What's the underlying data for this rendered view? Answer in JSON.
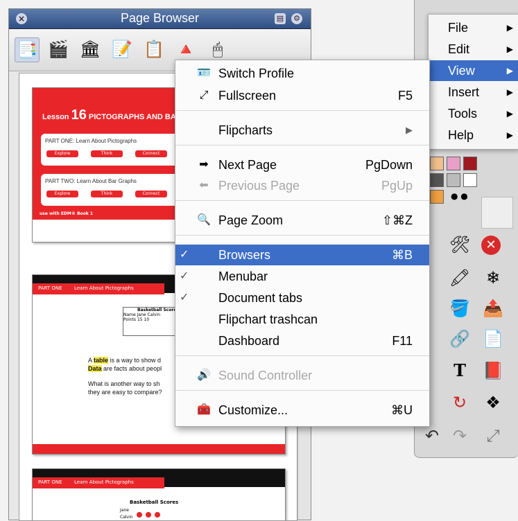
{
  "page_browser": {
    "title": "Page Browser",
    "close_glyph": "×",
    "toolbar_icons": [
      "page-browser-icon",
      "resource-browser-icon",
      "object-browser-icon",
      "notes-browser-icon",
      "property-browser-icon",
      "action-browser-icon",
      "voting-browser-icon"
    ],
    "thumb1": {
      "lesson_word": "Lesson",
      "lesson_num": "16",
      "lesson_title": "PICTOGRAPHS AND BA",
      "part1": "PART ONE: Learn About Pictographs",
      "part2": "PART TWO: Learn About Bar Graphs",
      "buttons": [
        "Explore",
        "Think",
        "Connect"
      ],
      "footer": "use with EDM® Book 1"
    },
    "thumb2": {
      "tab_part": "PART ONE",
      "tab_title": "Learn About Pictographs",
      "table_title": "Basketball Scores",
      "table_rows": [
        "Name",
        "Points"
      ],
      "table_cols": [
        "Jane",
        "Calvin"
      ],
      "table_nums": [
        "15",
        "10"
      ],
      "line1_hl": "table",
      "line1_rest": " is a way to show d",
      "line2_hl": "Data",
      "line2_rest": " are facts about peopl",
      "line3": "What is another way to sh",
      "line4": "they are easy to compare?"
    },
    "thumb3": {
      "tab_part": "PART ONE",
      "tab_title": "Learn About Pictographs",
      "table_title": "Basketball Scores",
      "row_labels": [
        "Jane",
        "Calvin"
      ]
    }
  },
  "main_menu": {
    "items": [
      {
        "label": "File",
        "arrow": "▶"
      },
      {
        "label": "Edit",
        "arrow": "▶"
      },
      {
        "label": "View",
        "arrow": "▶"
      },
      {
        "label": "Insert",
        "arrow": "▶"
      },
      {
        "label": "Tools",
        "arrow": "▶"
      },
      {
        "label": "Help",
        "arrow": "▶"
      }
    ],
    "selected": "View"
  },
  "view_menu": {
    "items": [
      {
        "label": "Switch Profile",
        "shortcut": "",
        "icon": "switch-profile-icon",
        "enabled": true,
        "checked": false
      },
      {
        "label": "Fullscreen",
        "shortcut": "F5",
        "icon": "fullscreen-icon",
        "enabled": true,
        "checked": false
      },
      {
        "label": "Flipcharts",
        "shortcut": "▶",
        "icon": "",
        "enabled": true,
        "checked": false
      },
      {
        "label": "Next Page",
        "shortcut": "PgDown",
        "icon": "next-page-icon",
        "enabled": true,
        "checked": false
      },
      {
        "label": "Previous Page",
        "shortcut": "PgUp",
        "icon": "previous-page-icon",
        "enabled": false,
        "checked": false
      },
      {
        "label": "Page Zoom",
        "shortcut": "⇧⌘Z",
        "icon": "zoom-icon",
        "enabled": true,
        "checked": false
      },
      {
        "label": "Browsers",
        "shortcut": "⌘B",
        "icon": "",
        "enabled": true,
        "checked": true,
        "selected": true
      },
      {
        "label": "Menubar",
        "shortcut": "",
        "icon": "",
        "enabled": true,
        "checked": true
      },
      {
        "label": "Document tabs",
        "shortcut": "",
        "icon": "",
        "enabled": true,
        "checked": true
      },
      {
        "label": "Flipchart trashcan",
        "shortcut": "",
        "icon": "",
        "enabled": true,
        "checked": false
      },
      {
        "label": "Dashboard",
        "shortcut": "F11",
        "icon": "",
        "enabled": true,
        "checked": false
      },
      {
        "label": "Sound Controller",
        "shortcut": "",
        "icon": "sound-controller-icon",
        "enabled": false,
        "checked": false
      },
      {
        "label": "Customize...",
        "shortcut": "⌘U",
        "icon": "customize-icon",
        "enabled": true,
        "checked": false
      }
    ],
    "check_glyph": "✓"
  },
  "colors": {
    "menu_highlight": "#3c6ec7",
    "title_bar": "#3a5a8f",
    "lesson_red": "#e8262a"
  }
}
